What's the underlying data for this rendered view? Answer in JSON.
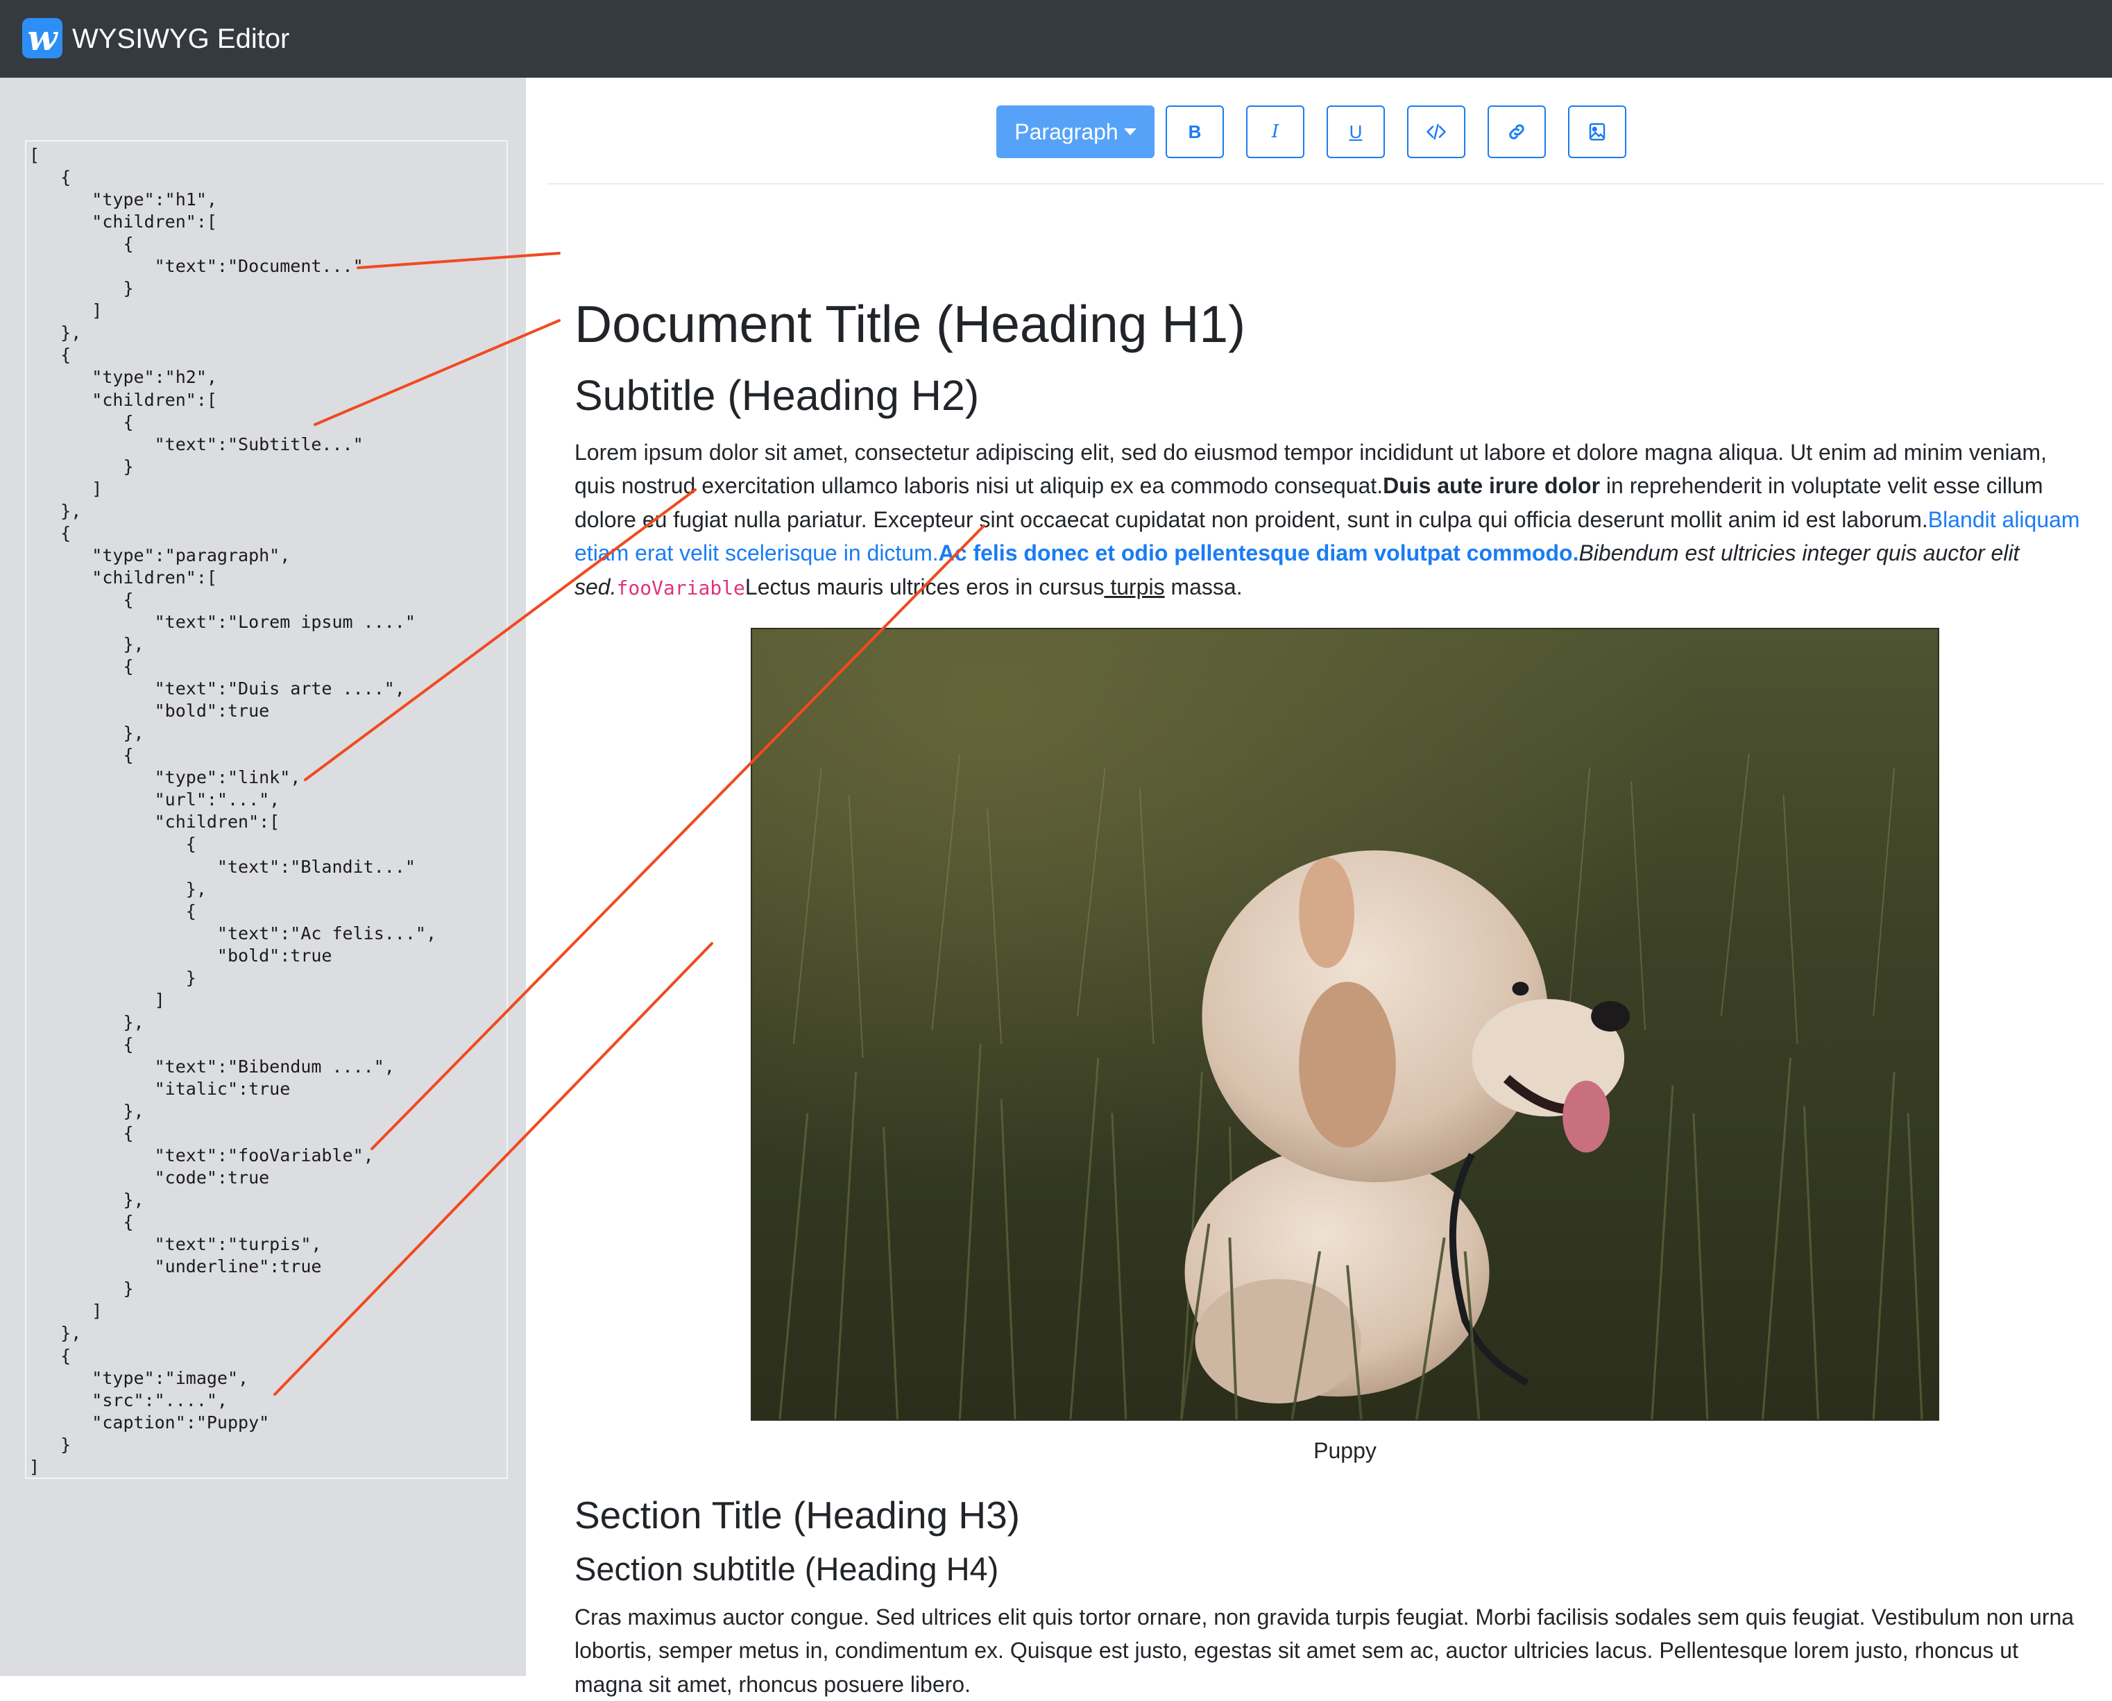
{
  "app": {
    "logo_letter": "w",
    "title": "WYSIWYG Editor"
  },
  "sidebar": {
    "json_text": "[\n   {\n      \"type\":\"h1\",\n      \"children\":[\n         {\n            \"text\":\"Document...\"\n         }\n      ]\n   },\n   {\n      \"type\":\"h2\",\n      \"children\":[\n         {\n            \"text\":\"Subtitle...\"\n         }\n      ]\n   },\n   {\n      \"type\":\"paragraph\",\n      \"children\":[\n         {\n            \"text\":\"Lorem ipsum ....\"\n         },\n         {\n            \"text\":\"Duis arte ....\",\n            \"bold\":true\n         },\n         {\n            \"type\":\"link\",\n            \"url\":\"...\",\n            \"children\":[\n               {\n                  \"text\":\"Blandit...\"\n               },\n               {\n                  \"text\":\"Ac felis...\",\n                  \"bold\":true\n               }\n            ]\n         },\n         {\n            \"text\":\"Bibendum ....\",\n            \"italic\":true\n         },\n         {\n            \"text\":\"fooVariable\",\n            \"code\":true\n         },\n         {\n            \"text\":\"turpis\",\n            \"underline\":true\n         }\n      ]\n   },\n   {\n      \"type\":\"image\",\n      \"src\":\"....\",\n      \"caption\":\"Puppy\"\n   }\n]"
  },
  "toolbar": {
    "block_type": "Paragraph",
    "buttons": [
      {
        "name": "bold",
        "label": "B",
        "icon": "bold-icon"
      },
      {
        "name": "italic",
        "label": "I",
        "icon": "italic-icon"
      },
      {
        "name": "underline",
        "label": "U",
        "icon": "underline-icon"
      },
      {
        "name": "code",
        "icon": "code-icon"
      },
      {
        "name": "link",
        "icon": "link-icon"
      },
      {
        "name": "image",
        "icon": "image-icon"
      }
    ]
  },
  "document": {
    "h1": "Document Title (Heading H1)",
    "h2": "Subtitle (Heading H2)",
    "paragraph": {
      "plain": "Lorem ipsum dolor sit amet, consectetur adipiscing elit, sed do eiusmod tempor incididunt ut labore et dolore magna aliqua. Ut enim ad minim veniam, quis nostrud exercitation ullamco laboris nisi ut aliquip ex ea commodo consequat.",
      "bold": "Duis aute irure dolor",
      "after_bold": " in reprehenderit in voluptate velit esse cillum dolore eu fugiat nulla pariatur. Excepteur sint occaecat cupidatat non proident, sunt in culpa qui officia deserunt mollit anim id est laborum.",
      "link_text": "Blandit aliquam etiam erat velit scelerisque in dictum.",
      "link_bold": "Ac felis donec et odio pellentesque diam volutpat commodo.",
      "italic": "Bibendum est ultricies integer quis auctor elit sed.",
      "code": "fooVariable",
      "after_code": "Lectus mauris ultrices eros in cursus",
      "underline": " turpis",
      "end": " massa."
    },
    "image_caption": "Puppy",
    "h3": "Section Title (Heading H3)",
    "h4": "Section subtitle (Heading H4)",
    "paragraph2": "Cras maximus auctor congue. Sed ultrices elit quis tortor ornare, non gravida turpis feugiat. Morbi facilisis sodales sem quis feugiat. Vestibulum non urna lobortis, semper metus in, condimentum ex. Quisque est justo, egestas sit amet sem ac, auctor ultricies lacus. Pellentesque lorem justo, rhoncus ut magna sit amet, rhoncus posuere libero."
  },
  "colors": {
    "navbar": "#343a40",
    "sidebar": "#dcdde1",
    "accent": "#1a7cf4",
    "dropdown": "#56a2f8",
    "annotation": "#f04a20",
    "code": "#e0337d"
  }
}
